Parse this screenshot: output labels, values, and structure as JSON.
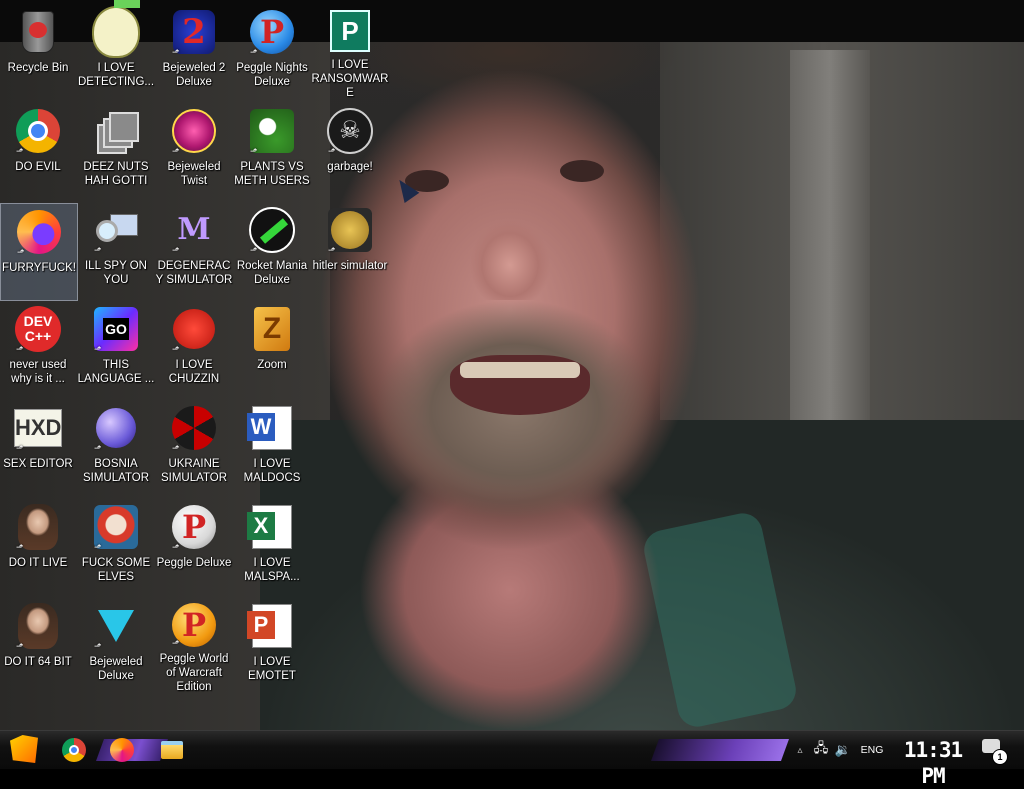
{
  "desktop": {
    "icons": [
      {
        "label": "Recycle Bin",
        "art": "recycle-bin"
      },
      {
        "label": "I LOVE DETECTING...",
        "art": "egg-mascot"
      },
      {
        "label": "Bejeweled 2 Deluxe",
        "art": "bejeweled-2"
      },
      {
        "label": "Peggle Nights Deluxe",
        "art": "peggle-nights"
      },
      {
        "label": "I LOVE RANSOMWARE",
        "art": "publisher"
      },
      {
        "label": "DO EVIL",
        "art": "chrome"
      },
      {
        "label": "DEEZ NUTS HAH GOTTI",
        "art": "copies"
      },
      {
        "label": "Bejeweled Twist",
        "art": "bejeweled-twist"
      },
      {
        "label": "PLANTS VS METH USERS",
        "art": "plants-vs-zombies"
      },
      {
        "label": "garbage!",
        "art": "warhammer"
      },
      {
        "label": "FURRYFUCK!",
        "art": "firefox"
      },
      {
        "label": "ILL SPY ON YOU",
        "art": "spy-tool"
      },
      {
        "label": "DEGENERACY SIMULATOR",
        "art": "dm-logo"
      },
      {
        "label": "Rocket Mania Deluxe",
        "art": "rocket-mania"
      },
      {
        "label": "hitler simulator",
        "art": "coin"
      },
      {
        "label": "never used why is it ...",
        "art": "dev-cpp"
      },
      {
        "label": "THIS LANGUAGE ...",
        "art": "goland"
      },
      {
        "label": "I LOVE CHUZZIN",
        "art": "chuzzle"
      },
      {
        "label": "Zoom",
        "art": "zuma"
      },
      {
        "label": "SEX EDITOR",
        "art": "hxd"
      },
      {
        "label": "BOSNIA SIMULATOR",
        "art": "minesweeper"
      },
      {
        "label": "UKRAINE SIMULATOR",
        "art": "radiation"
      },
      {
        "label": "I LOVE MALDOCS",
        "art": "word"
      },
      {
        "label": "DO IT LIVE",
        "art": "portrait"
      },
      {
        "label": "FUCK SOME ELVES",
        "art": "elves"
      },
      {
        "label": "Peggle Deluxe",
        "art": "peggle"
      },
      {
        "label": "I LOVE MALSPA...",
        "art": "excel"
      },
      {
        "label": "DO IT 64 BIT",
        "art": "portrait-64"
      },
      {
        "label": "Bejeweled Deluxe",
        "art": "gem"
      },
      {
        "label": "Peggle World of Warcraft Edition",
        "art": "peggle-wow"
      },
      {
        "label": "I LOVE EMOTET",
        "art": "powerpoint"
      }
    ],
    "selected": "FURRYFUCK!"
  },
  "taskbar": {
    "pinned": [
      "chrome-icon",
      "firefox-icon",
      "file-explorer-icon"
    ],
    "tray": {
      "chevron": "▵",
      "network": "🖧",
      "volume": "🔉",
      "language": "ENG"
    },
    "clock": "11:31 PM",
    "notification_count": "1"
  },
  "icon_glyphs": {
    "bejeweled-2": "2",
    "peggle": "P",
    "publisher": "P",
    "goland": "GO",
    "dev-cpp": "DEV C++",
    "zuma": "Z",
    "hxd": "HXD",
    "word": "W",
    "excel": "X",
    "powerpoint": "P",
    "dm-logo": "M",
    "warhammer": "☠"
  }
}
